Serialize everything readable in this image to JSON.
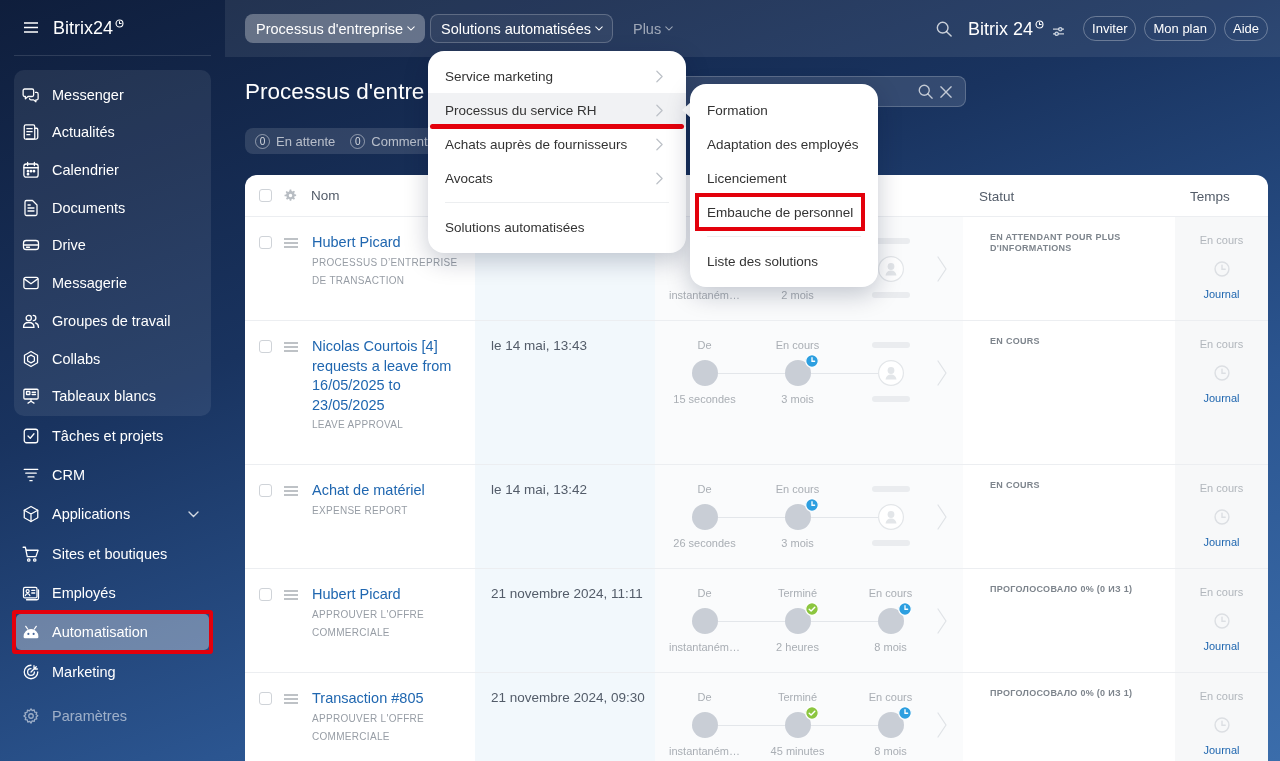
{
  "sidebar": {
    "logo": "Bitrix24",
    "panel_items": [
      {
        "label": "Messenger",
        "kind": "link",
        "selected": false
      },
      {
        "label": "Actualités",
        "kind": "link",
        "selected": false
      },
      {
        "label": "Calendrier",
        "kind": "link",
        "selected": false
      },
      {
        "label": "Documents",
        "kind": "link",
        "selected": false
      },
      {
        "label": "Drive",
        "kind": "link",
        "selected": false
      },
      {
        "label": "Messagerie",
        "kind": "link",
        "selected": false
      },
      {
        "label": "Groupes de travail",
        "kind": "link",
        "selected": false
      },
      {
        "label": "Collabs",
        "kind": "link",
        "selected": false
      },
      {
        "label": "Tableaux blancs",
        "kind": "link",
        "selected": false
      }
    ],
    "items": [
      {
        "label": "Tâches et projets",
        "kind": "link",
        "selected": false,
        "framed": false
      },
      {
        "label": "CRM",
        "kind": "link",
        "selected": false,
        "framed": false
      },
      {
        "label": "Applications",
        "kind": "expandable",
        "expanded": false,
        "selected": false,
        "framed": false
      },
      {
        "label": "Sites et boutiques",
        "kind": "link",
        "selected": false,
        "framed": false
      },
      {
        "label": "Employés",
        "kind": "link",
        "selected": false,
        "framed": false
      },
      {
        "label": "Automatisation",
        "kind": "link",
        "selected": true,
        "framed": true
      },
      {
        "label": "Marketing",
        "kind": "link",
        "selected": false,
        "framed": false
      }
    ],
    "settings": {
      "label": "Paramètres"
    }
  },
  "topbar": {
    "tabs": [
      {
        "label": "Processus d'entreprise",
        "selected": true,
        "open": false
      },
      {
        "label": "Solutions automatisées",
        "selected": false,
        "open": true
      },
      {
        "label": "Plus",
        "selected": false,
        "open": false
      }
    ],
    "logo": "Bitrix 24",
    "buttons": [
      "Inviter",
      "Mon plan",
      "Aide"
    ]
  },
  "page": {
    "title": "Processus d'entre",
    "counters": [
      {
        "count": "0",
        "label": "En attente"
      },
      {
        "count": "0",
        "label": "Comment"
      }
    ]
  },
  "table": {
    "header_checked": false,
    "columns": {
      "name": "Nom",
      "status": "Statut",
      "time": "Temps"
    },
    "rows": [
      {
        "checked": false,
        "title": "Hubert Picard",
        "subtitle": "PROCESSUS D’ENTREPRISE DE TRANSACTION",
        "steps": [
          {
            "kind": "covered",
            "time": "instantaném…"
          },
          {
            "kind": "covered",
            "time": "2 mois"
          },
          {
            "kind": "vacant"
          }
        ],
        "status": "EN ATTENDANT POUR PLUS D'INFORMATIONS",
        "time_status": "En cours",
        "log": "Journal"
      },
      {
        "checked": false,
        "title": "Nicolas Courtois [4] requests a leave from 16/05/2025 to 23/05/2025",
        "subtitle": "LEAVE APPROVAL",
        "date": "le 14 mai, 13:43",
        "steps": [
          {
            "kind": "author",
            "label": "De",
            "time": "15 secondes"
          },
          {
            "kind": "waiting",
            "label": "En cours",
            "time": "3 mois"
          },
          {
            "kind": "vacant"
          }
        ],
        "status": "EN COURS",
        "time_status": "En cours",
        "log": "Journal"
      },
      {
        "checked": false,
        "title": "Achat de matériel",
        "subtitle": "EXPENSE REPORT",
        "date": "le 14 mai, 13:42",
        "steps": [
          {
            "kind": "author",
            "label": "De",
            "time": "26 secondes"
          },
          {
            "kind": "waiting",
            "label": "En cours",
            "time": "3 mois"
          },
          {
            "kind": "vacant"
          }
        ],
        "status": "EN COURS",
        "time_status": "En cours",
        "log": "Journal"
      },
      {
        "checked": false,
        "title": "Hubert Picard",
        "subtitle": "APPROUVER L'OFFRE COMMERCIALE",
        "date": "21 novembre 2024, 11:11",
        "steps": [
          {
            "kind": "author",
            "label": "De",
            "time": "instantaném…"
          },
          {
            "kind": "done",
            "label": "Terminé",
            "time": "2 heures"
          },
          {
            "kind": "waiting",
            "label": "En cours",
            "time": "8 mois"
          }
        ],
        "status": "ПРОГОЛОСОВАЛО 0% (0 ИЗ 1)",
        "time_status": "En cours",
        "log": "Journal"
      },
      {
        "checked": false,
        "title": "Transaction #805",
        "subtitle": "APPROUVER L'OFFRE COMMERCIALE",
        "date": "21 novembre 2024, 09:30",
        "steps": [
          {
            "kind": "author",
            "label": "De",
            "time": "instantaném…"
          },
          {
            "kind": "done",
            "label": "Terminé",
            "time": "45 minutes"
          },
          {
            "kind": "waiting",
            "label": "En cours",
            "time": "8 mois"
          }
        ],
        "status": "ПРОГОЛОСОВАЛО 0% (0 ИЗ 1)",
        "time_status": "En cours",
        "log": "Journal"
      }
    ]
  },
  "menu": {
    "items": [
      {
        "label": "Service marketing",
        "kind": "submenu",
        "selected": false,
        "underlined": false
      },
      {
        "label": "Processus du service RH",
        "kind": "submenu",
        "selected": true,
        "underlined": true
      },
      {
        "label": "Achats auprès de fournisseurs",
        "kind": "submenu",
        "selected": false,
        "underlined": false
      },
      {
        "label": "Avocats",
        "kind": "submenu",
        "selected": false,
        "underlined": false
      },
      {
        "kind": "divider"
      },
      {
        "label": "Solutions automatisées",
        "kind": "link",
        "selected": false,
        "underlined": false
      }
    ]
  },
  "submenu": {
    "items": [
      {
        "label": "Formation",
        "kind": "link",
        "selected": false,
        "framed": false
      },
      {
        "label": "Adaptation des employés",
        "kind": "link",
        "selected": false,
        "framed": false
      },
      {
        "label": "Licenciement",
        "kind": "link",
        "selected": false,
        "framed": false
      },
      {
        "label": "Embauche de personnel",
        "kind": "link",
        "selected": false,
        "framed": true
      },
      {
        "kind": "divider"
      },
      {
        "label": "Liste des solutions",
        "kind": "link",
        "selected": false,
        "framed": false
      }
    ]
  }
}
